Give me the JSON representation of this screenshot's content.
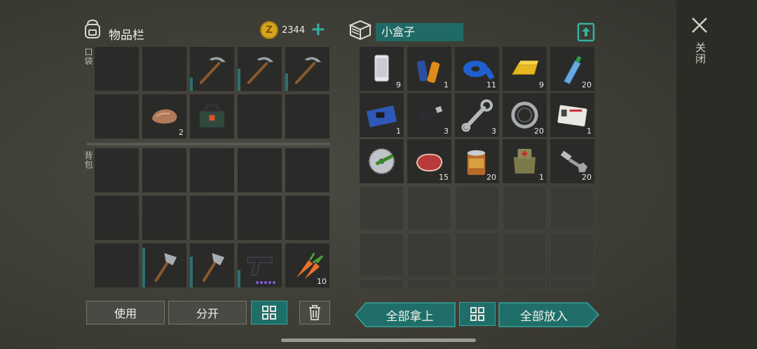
{
  "inventory": {
    "title": "物品栏",
    "coins": "2344",
    "pocket_label": "口袋",
    "backpack_label": "背包"
  },
  "pocket_slots": [
    {
      "item": "",
      "count": ""
    },
    {
      "item": "",
      "count": ""
    },
    {
      "item": "pickaxe",
      "count": "",
      "durability": 0.3
    },
    {
      "item": "pickaxe",
      "count": "",
      "durability": 0.5
    },
    {
      "item": "pickaxe",
      "count": "",
      "durability": 0.4
    },
    {
      "item": "",
      "count": ""
    },
    {
      "item": "stone",
      "count": "2"
    },
    {
      "item": "toolbox",
      "count": ""
    },
    {
      "item": "",
      "count": ""
    },
    {
      "item": "",
      "count": ""
    }
  ],
  "backpack_slots": [
    {
      "item": "",
      "count": ""
    },
    {
      "item": "",
      "count": ""
    },
    {
      "item": "",
      "count": ""
    },
    {
      "item": "",
      "count": ""
    },
    {
      "item": "",
      "count": ""
    },
    {
      "item": "",
      "count": ""
    },
    {
      "item": "",
      "count": ""
    },
    {
      "item": "",
      "count": ""
    },
    {
      "item": "",
      "count": ""
    },
    {
      "item": "",
      "count": ""
    },
    {
      "item": "",
      "count": ""
    },
    {
      "item": "hatchet",
      "count": "",
      "durability": 0.9
    },
    {
      "item": "hatchet",
      "count": "",
      "durability": 0.7
    },
    {
      "item": "pistol",
      "count": "",
      "durability": 0.4
    },
    {
      "item": "carrot",
      "count": "10"
    }
  ],
  "box": {
    "title": "小盒子"
  },
  "box_slots": [
    {
      "item": "phone",
      "count": "9"
    },
    {
      "item": "batteries",
      "count": "1"
    },
    {
      "item": "tape",
      "count": "11"
    },
    {
      "item": "gold-bar",
      "count": "9"
    },
    {
      "item": "water-bottle",
      "count": "20"
    },
    {
      "item": "circuit-board",
      "count": "1"
    },
    {
      "item": "usb-drive",
      "count": "3"
    },
    {
      "item": "wrench",
      "count": "3"
    },
    {
      "item": "bearing",
      "count": "20"
    },
    {
      "item": "army-id-card",
      "count": "1"
    },
    {
      "item": "saw-blade",
      "count": ""
    },
    {
      "item": "steak",
      "count": "15"
    },
    {
      "item": "canned-food",
      "count": "20"
    },
    {
      "item": "medkit",
      "count": "1"
    },
    {
      "item": "bolt-nut",
      "count": "20"
    }
  ],
  "buttons": {
    "use": "使用",
    "split": "分开",
    "take_all": "全部拿上",
    "put_all": "全部放入",
    "close": "关闭"
  },
  "colors": {
    "accent": "#1f6e69",
    "accent_border": "#37a39a",
    "coin": "#d7a51c"
  }
}
